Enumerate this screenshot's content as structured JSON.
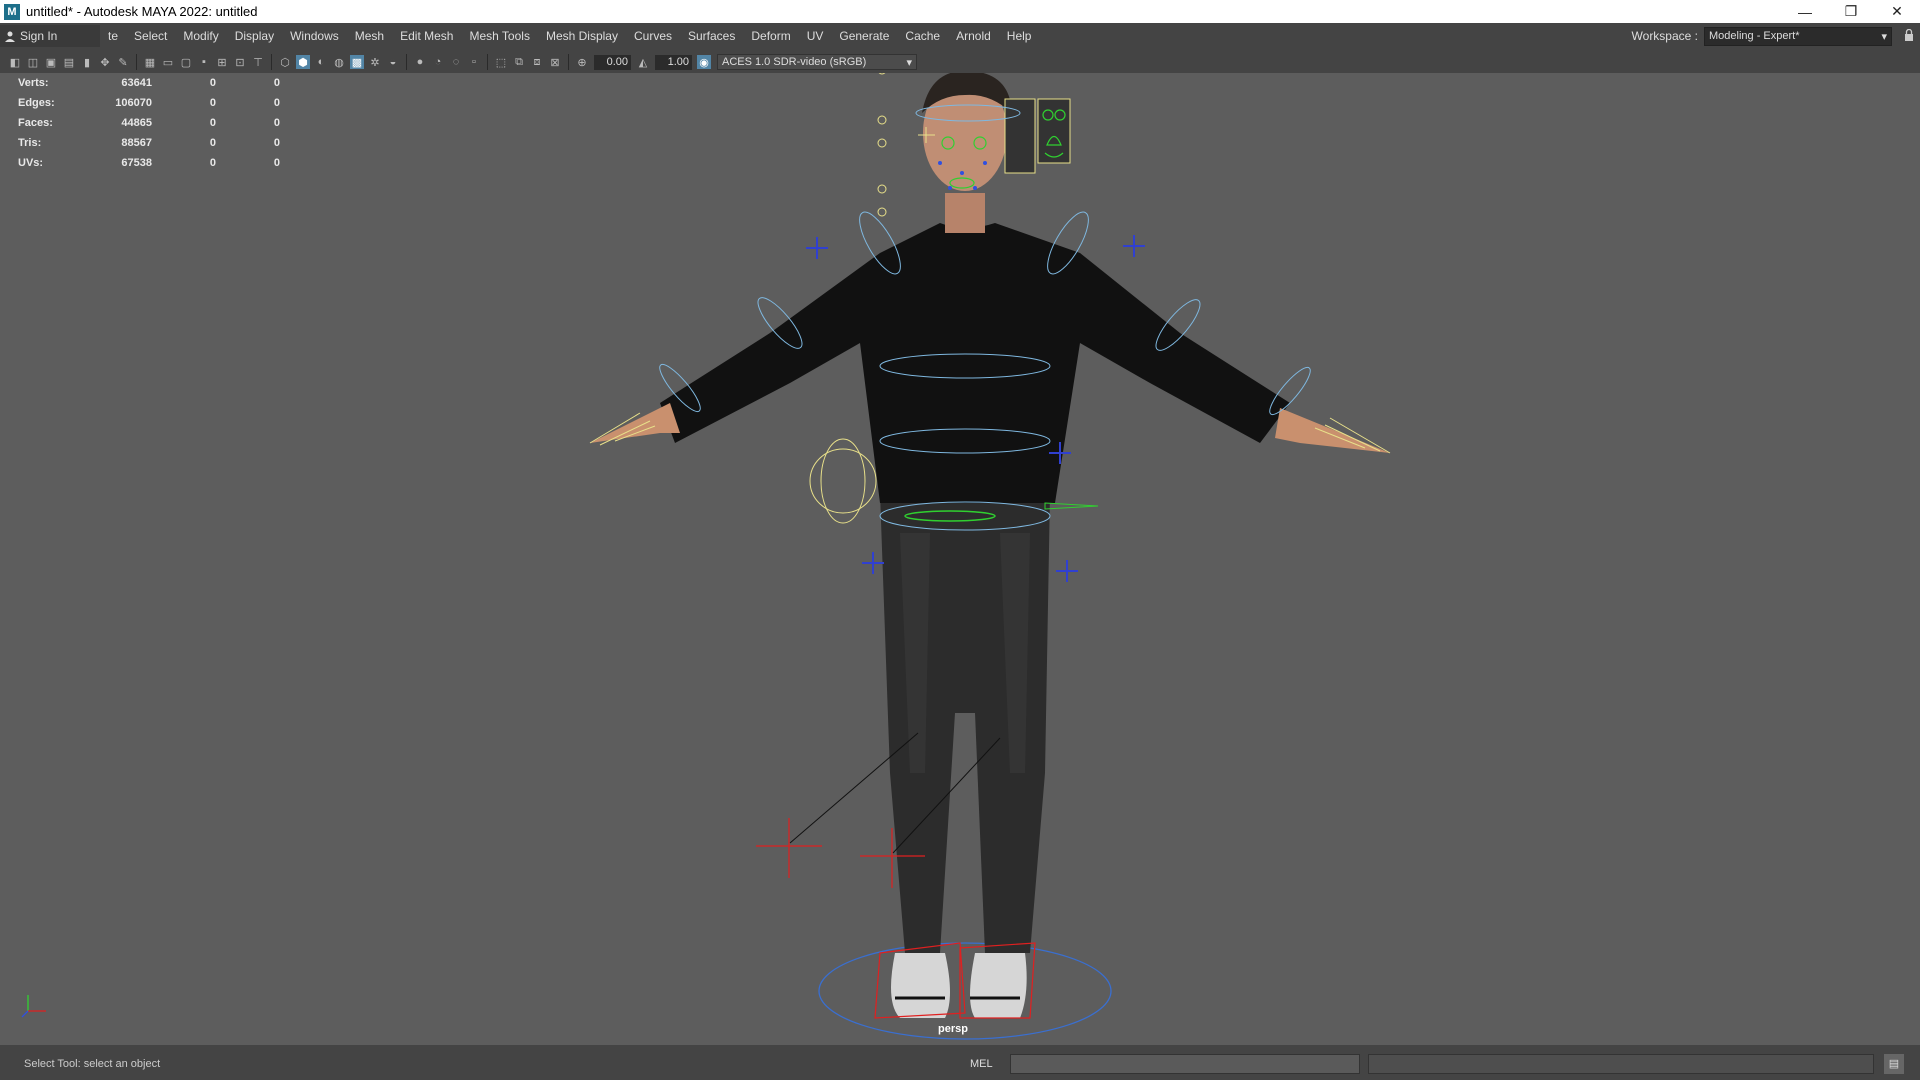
{
  "window": {
    "title": "untitled* - Autodesk MAYA 2022: untitled",
    "app_icon_letter": "M",
    "min_icon": "—",
    "max_icon": "❐",
    "close_icon": "✕"
  },
  "menubar": {
    "sign_in": "Sign In",
    "items": [
      "te",
      "Select",
      "Modify",
      "Display",
      "Windows",
      "Mesh",
      "Edit Mesh",
      "Mesh Tools",
      "Mesh Display",
      "Curves",
      "Surfaces",
      "Deform",
      "UV",
      "Generate",
      "Cache",
      "Arnold",
      "Help"
    ],
    "workspace_label": "Workspace :",
    "workspace_value": "Modeling - Expert*"
  },
  "toolbar": {
    "exposure": "0.00",
    "gamma": "1.00",
    "color_space": "ACES 1.0 SDR-video (sRGB)"
  },
  "hud": {
    "rows": [
      {
        "label": "Verts:",
        "v1": "63641",
        "v2": "0",
        "v3": "0"
      },
      {
        "label": "Edges:",
        "v1": "106070",
        "v2": "0",
        "v3": "0"
      },
      {
        "label": "Faces:",
        "v1": "44865",
        "v2": "0",
        "v3": "0"
      },
      {
        "label": "Tris:",
        "v1": "88567",
        "v2": "0",
        "v3": "0"
      },
      {
        "label": "UVs:",
        "v1": "67538",
        "v2": "0",
        "v3": "0"
      }
    ]
  },
  "viewport": {
    "camera_label": "persp"
  },
  "statusbar": {
    "help_text": "Select Tool: select an object",
    "command_language": "MEL"
  },
  "colors": {
    "viewport_bg": "#5d5d5d",
    "ui_bg": "#444444",
    "accent": "#5285a6",
    "ctrl_blue": "#7fb8e0",
    "ctrl_yellow": "#e8e08a",
    "ctrl_green": "#30d030",
    "ctrl_red": "#e02020"
  }
}
